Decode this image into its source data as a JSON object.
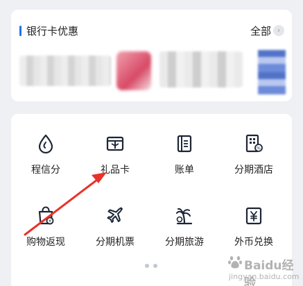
{
  "promo": {
    "title": "银行卡优惠",
    "all_label": "全部",
    "accent_color": "#1e73e6"
  },
  "services": {
    "items": [
      {
        "label": "程信分",
        "icon": "drop-icon"
      },
      {
        "label": "礼品卡",
        "icon": "gift-card-icon"
      },
      {
        "label": "账单",
        "icon": "bill-icon"
      },
      {
        "label": "分期酒店",
        "icon": "hotel-icon"
      },
      {
        "label": "购物返现",
        "icon": "shopping-bag-icon"
      },
      {
        "label": "分期机票",
        "icon": "airplane-icon"
      },
      {
        "label": "分期旅游",
        "icon": "palm-tree-icon"
      },
      {
        "label": "外币兑换",
        "icon": "currency-exchange-icon"
      }
    ],
    "page_count": 2,
    "active_page": 1,
    "icon_color": "#1c2536"
  },
  "annotation": {
    "arrow_color": "#e8322a"
  },
  "watermark": {
    "text": "Baidu经验",
    "url": "jingyan.baidu.com"
  }
}
